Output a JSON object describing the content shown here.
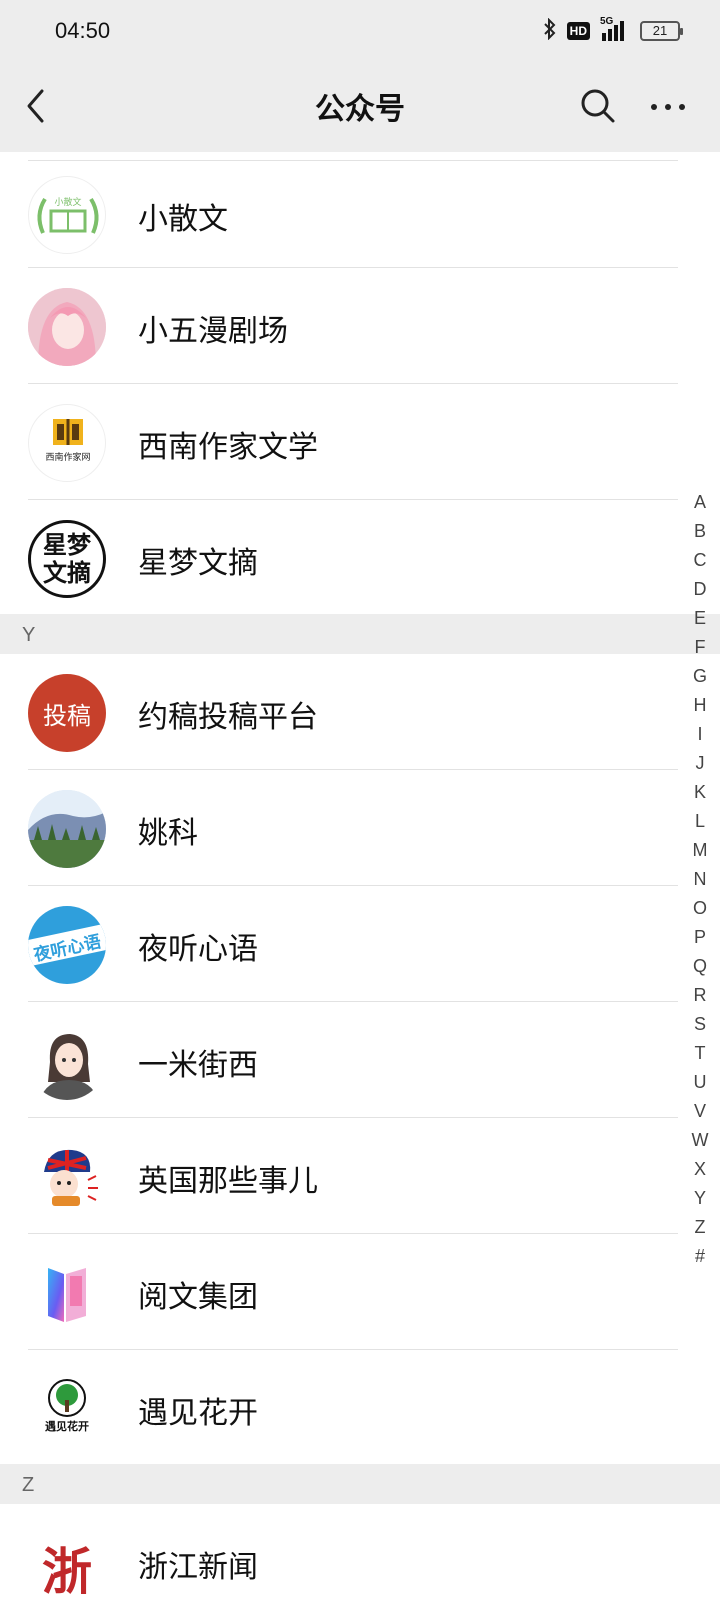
{
  "status_bar": {
    "time": "04:50",
    "network": "5G",
    "hd": "HD",
    "battery": "21"
  },
  "nav": {
    "title": "公众号"
  },
  "sections": [
    {
      "letter": "",
      "items": [
        {
          "name": "小散文",
          "icon": "book-laurel-logo",
          "avatar_text": "小散文"
        },
        {
          "name": "小五漫剧场",
          "icon": "anime-girl-avatar",
          "avatar_text": ""
        },
        {
          "name": "西南作家文学",
          "icon": "open-book-logo",
          "avatar_text": "西南作家网"
        },
        {
          "name": "星梦文摘",
          "icon": "calligraphy-logo",
          "avatar_text": "星梦文摘"
        }
      ]
    },
    {
      "letter": "Y",
      "items": [
        {
          "name": "约稿投稿平台",
          "icon": "red-seal-logo",
          "avatar_text": "投稿"
        },
        {
          "name": "姚科",
          "icon": "mountain-landscape-avatar",
          "avatar_text": ""
        },
        {
          "name": "夜听心语",
          "icon": "blue-text-logo",
          "avatar_text": "夜听心语"
        },
        {
          "name": "一米街西",
          "icon": "girl-illustration-avatar",
          "avatar_text": ""
        },
        {
          "name": "英国那些事儿",
          "icon": "uk-flag-hat-avatar",
          "avatar_text": ""
        },
        {
          "name": "阅文集团",
          "icon": "gradient-book-logo",
          "avatar_text": ""
        },
        {
          "name": "遇见花开",
          "icon": "green-tree-logo",
          "avatar_text": "遇见花开"
        }
      ]
    },
    {
      "letter": "Z",
      "items": [
        {
          "name": "浙江新闻",
          "icon": "red-calligraphy-logo",
          "avatar_text": "浙"
        }
      ]
    }
  ],
  "index_letters": [
    "A",
    "B",
    "C",
    "D",
    "E",
    "F",
    "G",
    "H",
    "I",
    "J",
    "K",
    "L",
    "M",
    "N",
    "O",
    "P",
    "Q",
    "R",
    "S",
    "T",
    "U",
    "V",
    "W",
    "X",
    "Y",
    "Z",
    "#"
  ],
  "colors": {
    "header_bg": "#ededed",
    "section_bg": "#ededed",
    "text": "#111111",
    "separator": "#e2e2e2"
  }
}
